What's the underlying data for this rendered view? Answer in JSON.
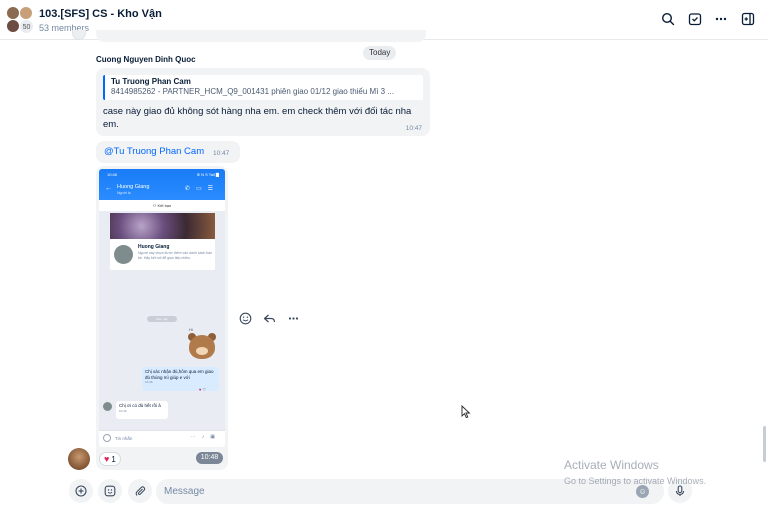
{
  "header": {
    "title": "103.[SFS] CS - Kho Vận",
    "members": "53 members",
    "avatar_count": "50"
  },
  "chat": {
    "date_divider": "Today",
    "sender_name": "Cuong Nguyen Dinh Quoc",
    "message1": {
      "quote_name": "Tu Truong Phan Cam",
      "quote_text": "8414985262 - PARTNER_HCM_Q9_001431 phiên giao 01/12 giao thiếu Mì 3 ...",
      "text": "case này giao đủ không sót hàng nha em. em check thêm với đối tác nha em.",
      "time": "10:47"
    },
    "message2": {
      "mention": "@Tu Truong Phan Cam",
      "time": "10:47"
    },
    "image_message": {
      "time": "10:48",
      "reaction_count": "1",
      "phone": {
        "status_left": "10:46",
        "status_right": "⊕ N S Tail ▇",
        "contact_name": "Huong Giang",
        "contact_sub": "Người lạ",
        "ketban": "Kết bạn",
        "card_name": "Huong Giang",
        "card_text": "Người này chưa được thêm vào danh sách bạn bè. Hãy kết nối để giao tiếp nhiều.",
        "time_badge": "hôm nay",
        "sticker_text": "Hi",
        "out_text": "Chị xác nhận đủ,hôm qua em giao đủ thùng mì giúp e với",
        "out_time": "10:46",
        "in_text": "Chị ơi có đủ hết rồi ả",
        "in_time": "10:46",
        "input_placeholder": "Tin nhắn"
      }
    }
  },
  "composer": {
    "placeholder": "Message"
  },
  "watermark": {
    "line1": "Activate Windows",
    "line2": "Go to Settings to activate Windows."
  },
  "colors": {
    "accent": "#0068ff",
    "bubble": "#f1f3f5",
    "heart": "#e0245e"
  }
}
